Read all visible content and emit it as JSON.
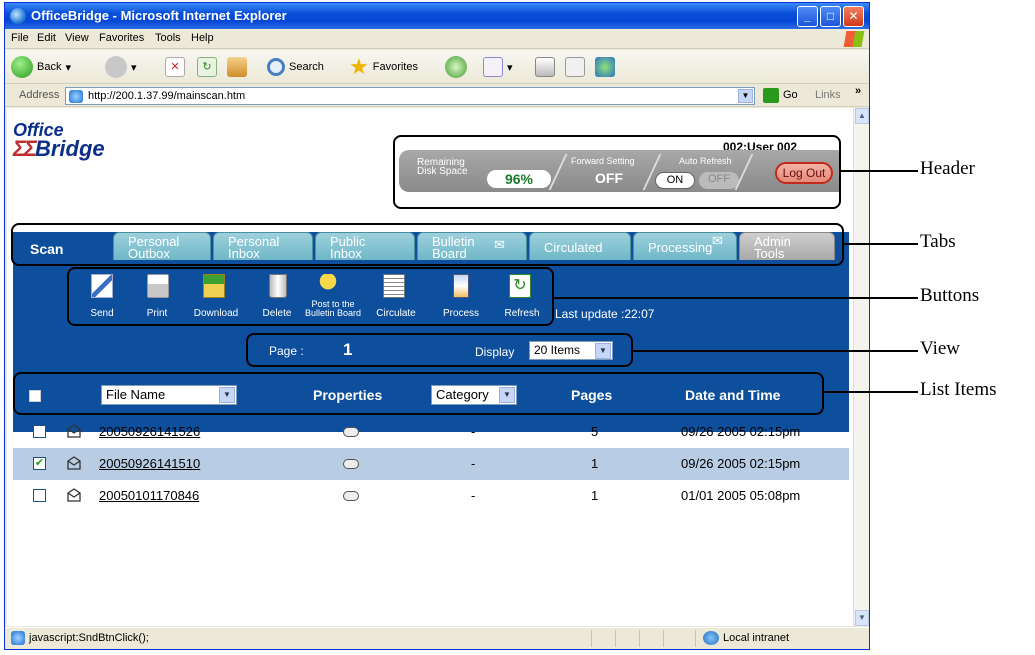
{
  "window": {
    "title": "OfficeBridge - Microsoft Internet Explorer"
  },
  "menu": [
    "File",
    "Edit",
    "View",
    "Favorites",
    "Tools",
    "Help"
  ],
  "toolbar": {
    "back": "Back",
    "search": "Search",
    "favorites": "Favorites"
  },
  "address": {
    "label": "Address",
    "url": "http://200.1.37.99/mainscan.htm",
    "go": "Go",
    "links": "Links"
  },
  "logo": {
    "top": "Office",
    "bottom": "Bridge"
  },
  "header": {
    "user": "002:User 002",
    "disk_label_1": "Remaining",
    "disk_label_2": "Disk Space",
    "disk_value": "96%",
    "forward_label": "Forward Setting",
    "forward_value": "OFF",
    "refresh_label": "Auto Refresh",
    "refresh_on": "ON",
    "refresh_off": "OFF",
    "logout": "Log Out"
  },
  "tabs": [
    {
      "l1": "Scan",
      "l2": ""
    },
    {
      "l1": "Personal",
      "l2": "Outbox"
    },
    {
      "l1": "Personal",
      "l2": "Inbox"
    },
    {
      "l1": "Public",
      "l2": "Inbox"
    },
    {
      "l1": "Bulletin",
      "l2": "Board"
    },
    {
      "l1": "Circulated",
      "l2": ""
    },
    {
      "l1": "Processing",
      "l2": ""
    },
    {
      "l1": "Admin",
      "l2": "Tools"
    }
  ],
  "buttons": [
    {
      "label": "Send",
      "label2": ""
    },
    {
      "label": "Print",
      "label2": ""
    },
    {
      "label": "Download",
      "label2": ""
    },
    {
      "label": "Delete",
      "label2": ""
    },
    {
      "label": "Post to the",
      "label2": "Bulletin Board"
    },
    {
      "label": "Circulate",
      "label2": ""
    },
    {
      "label": "Process",
      "label2": ""
    },
    {
      "label": "Refresh",
      "label2": ""
    }
  ],
  "last_update": "Last update :22:07",
  "view": {
    "page_label": "Page :",
    "page_value": "1",
    "display_label": "Display",
    "display_value": "20 Items"
  },
  "list": {
    "col_filename": "File Name",
    "col_properties": "Properties",
    "col_category": "Category",
    "col_pages": "Pages",
    "col_datetime": "Date and Time",
    "rows": [
      {
        "checked": "",
        "name": "20050926141526",
        "category": "-",
        "pages": "5",
        "date": "09/26 2005 02:15pm"
      },
      {
        "checked": "✔",
        "name": "20050926141510",
        "category": "-",
        "pages": "1",
        "date": "09/26 2005 02:15pm"
      },
      {
        "checked": "",
        "name": "20050101170846",
        "category": "-",
        "pages": "1",
        "date": "01/01 2005 05:08pm"
      }
    ]
  },
  "status": {
    "text": "javascript:SndBtnClick();",
    "zone": "Local intranet"
  },
  "callouts": {
    "header": "Header",
    "tabs": "Tabs",
    "buttons": "Buttons",
    "view": "View",
    "list": "List Items"
  }
}
